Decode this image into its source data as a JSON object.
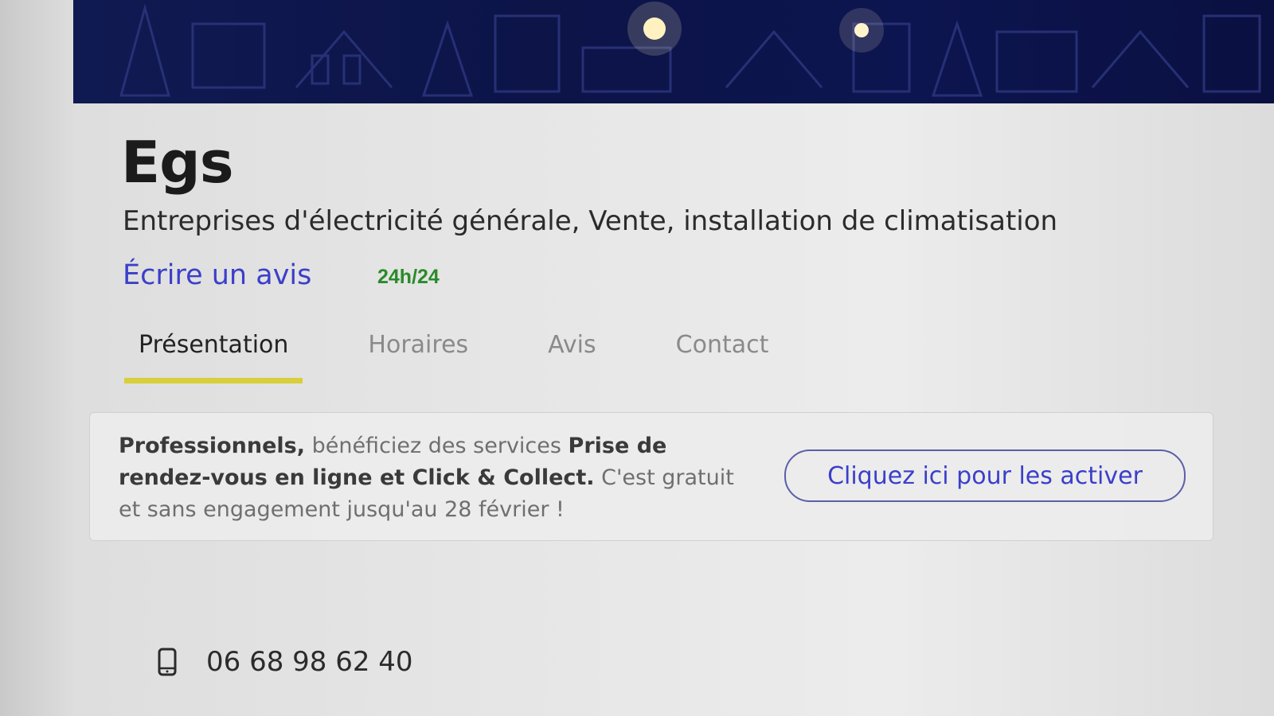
{
  "business": {
    "name": "Egs",
    "categories": "Entreprises d'électricité générale, Vente, installation de climatisation",
    "review_link": "Écrire un avis",
    "hours_badge": "24h/24"
  },
  "tabs": [
    {
      "label": "Présentation",
      "active": true
    },
    {
      "label": "Horaires",
      "active": false
    },
    {
      "label": "Avis",
      "active": false
    },
    {
      "label": "Contact",
      "active": false
    }
  ],
  "promo": {
    "bold_1": "Professionnels,",
    "text_1": " bénéficiez des services ",
    "bold_2": "Prise de rendez-vous en ligne et Click & Collect.",
    "text_2": " C'est gratuit et sans engagement jusqu'au 28 février !",
    "button_label": "Cliquez ici pour les activer"
  },
  "contact": {
    "phone": "06 68 98 62 40",
    "phone_icon": "mobile-phone-icon"
  },
  "colors": {
    "link": "#3b3fc9",
    "hours": "#2a8a2a",
    "tab_underline": "#d8cf3a",
    "banner": "#0c1448"
  }
}
